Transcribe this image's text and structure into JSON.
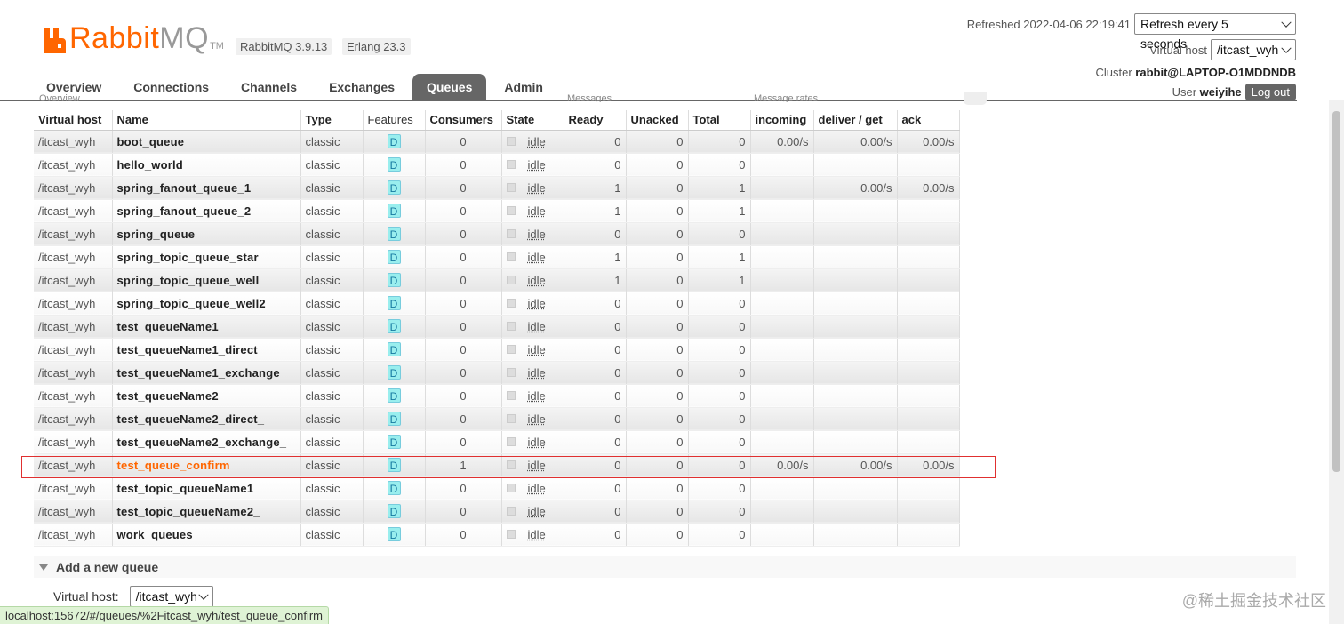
{
  "header": {
    "brand_r": "Rabbit",
    "brand_mq": "MQ",
    "trademark": "TM",
    "version": "RabbitMQ 3.9.13",
    "erlang": "Erlang 23.3",
    "refreshed_label": "Refreshed 2022-04-06 22:19:41",
    "refresh_select": "Refresh every 5 seconds",
    "vhost_label": "Virtual host",
    "vhost_select": "/itcast_wyh",
    "cluster_label": "Cluster",
    "cluster_value": "rabbit@LAPTOP-O1MDDNDB",
    "user_label": "User",
    "user_value": "weiyihe",
    "logout": "Log out"
  },
  "tabs": [
    "Overview",
    "Connections",
    "Channels",
    "Exchanges",
    "Queues",
    "Admin"
  ],
  "active_tab": "Queues",
  "partial_labels": {
    "overview": "Overview",
    "messages": "Messages",
    "rates": "Message rates"
  },
  "columns": [
    "Virtual host",
    "Name",
    "Type",
    "Features",
    "Consumers",
    "State",
    "Ready",
    "Unacked",
    "Total",
    "incoming",
    "deliver / get",
    "ack"
  ],
  "queues": [
    {
      "vhost": "/itcast_wyh",
      "name": "boot_queue",
      "type": "classic",
      "feature": "D",
      "consumers": "0",
      "state": "idle",
      "ready": "0",
      "unacked": "0",
      "total": "0",
      "incoming": "0.00/s",
      "deliver": "0.00/s",
      "ack": "0.00/s"
    },
    {
      "vhost": "/itcast_wyh",
      "name": "hello_world",
      "type": "classic",
      "feature": "D",
      "consumers": "0",
      "state": "idle",
      "ready": "0",
      "unacked": "0",
      "total": "0",
      "incoming": "",
      "deliver": "",
      "ack": ""
    },
    {
      "vhost": "/itcast_wyh",
      "name": "spring_fanout_queue_1",
      "type": "classic",
      "feature": "D",
      "consumers": "0",
      "state": "idle",
      "ready": "1",
      "unacked": "0",
      "total": "1",
      "incoming": "",
      "deliver": "0.00/s",
      "ack": "0.00/s"
    },
    {
      "vhost": "/itcast_wyh",
      "name": "spring_fanout_queue_2",
      "type": "classic",
      "feature": "D",
      "consumers": "0",
      "state": "idle",
      "ready": "1",
      "unacked": "0",
      "total": "1",
      "incoming": "",
      "deliver": "",
      "ack": ""
    },
    {
      "vhost": "/itcast_wyh",
      "name": "spring_queue",
      "type": "classic",
      "feature": "D",
      "consumers": "0",
      "state": "idle",
      "ready": "0",
      "unacked": "0",
      "total": "0",
      "incoming": "",
      "deliver": "",
      "ack": ""
    },
    {
      "vhost": "/itcast_wyh",
      "name": "spring_topic_queue_star",
      "type": "classic",
      "feature": "D",
      "consumers": "0",
      "state": "idle",
      "ready": "1",
      "unacked": "0",
      "total": "1",
      "incoming": "",
      "deliver": "",
      "ack": ""
    },
    {
      "vhost": "/itcast_wyh",
      "name": "spring_topic_queue_well",
      "type": "classic",
      "feature": "D",
      "consumers": "0",
      "state": "idle",
      "ready": "1",
      "unacked": "0",
      "total": "1",
      "incoming": "",
      "deliver": "",
      "ack": ""
    },
    {
      "vhost": "/itcast_wyh",
      "name": "spring_topic_queue_well2",
      "type": "classic",
      "feature": "D",
      "consumers": "0",
      "state": "idle",
      "ready": "0",
      "unacked": "0",
      "total": "0",
      "incoming": "",
      "deliver": "",
      "ack": ""
    },
    {
      "vhost": "/itcast_wyh",
      "name": "test_queueName1",
      "type": "classic",
      "feature": "D",
      "consumers": "0",
      "state": "idle",
      "ready": "0",
      "unacked": "0",
      "total": "0",
      "incoming": "",
      "deliver": "",
      "ack": ""
    },
    {
      "vhost": "/itcast_wyh",
      "name": "test_queueName1_direct",
      "type": "classic",
      "feature": "D",
      "consumers": "0",
      "state": "idle",
      "ready": "0",
      "unacked": "0",
      "total": "0",
      "incoming": "",
      "deliver": "",
      "ack": ""
    },
    {
      "vhost": "/itcast_wyh",
      "name": "test_queueName1_exchange",
      "type": "classic",
      "feature": "D",
      "consumers": "0",
      "state": "idle",
      "ready": "0",
      "unacked": "0",
      "total": "0",
      "incoming": "",
      "deliver": "",
      "ack": ""
    },
    {
      "vhost": "/itcast_wyh",
      "name": "test_queueName2",
      "type": "classic",
      "feature": "D",
      "consumers": "0",
      "state": "idle",
      "ready": "0",
      "unacked": "0",
      "total": "0",
      "incoming": "",
      "deliver": "",
      "ack": ""
    },
    {
      "vhost": "/itcast_wyh",
      "name": "test_queueName2_direct_",
      "type": "classic",
      "feature": "D",
      "consumers": "0",
      "state": "idle",
      "ready": "0",
      "unacked": "0",
      "total": "0",
      "incoming": "",
      "deliver": "",
      "ack": ""
    },
    {
      "vhost": "/itcast_wyh",
      "name": "test_queueName2_exchange_",
      "type": "classic",
      "feature": "D",
      "consumers": "0",
      "state": "idle",
      "ready": "0",
      "unacked": "0",
      "total": "0",
      "incoming": "",
      "deliver": "",
      "ack": ""
    },
    {
      "vhost": "/itcast_wyh",
      "name": "test_queue_confirm",
      "type": "classic",
      "feature": "D",
      "consumers": "1",
      "state": "idle",
      "ready": "0",
      "unacked": "0",
      "total": "0",
      "incoming": "0.00/s",
      "deliver": "0.00/s",
      "ack": "0.00/s",
      "highlighted": true
    },
    {
      "vhost": "/itcast_wyh",
      "name": "test_topic_queueName1",
      "type": "classic",
      "feature": "D",
      "consumers": "0",
      "state": "idle",
      "ready": "0",
      "unacked": "0",
      "total": "0",
      "incoming": "",
      "deliver": "",
      "ack": ""
    },
    {
      "vhost": "/itcast_wyh",
      "name": "test_topic_queueName2_",
      "type": "classic",
      "feature": "D",
      "consumers": "0",
      "state": "idle",
      "ready": "0",
      "unacked": "0",
      "total": "0",
      "incoming": "",
      "deliver": "",
      "ack": ""
    },
    {
      "vhost": "/itcast_wyh",
      "name": "work_queues",
      "type": "classic",
      "feature": "D",
      "consumers": "0",
      "state": "idle",
      "ready": "0",
      "unacked": "0",
      "total": "0",
      "incoming": "",
      "deliver": "",
      "ack": ""
    }
  ],
  "add_queue": {
    "section_title": "Add a new queue",
    "vhost_label": "Virtual host:",
    "vhost_value": "/itcast_wyh"
  },
  "status_url": "localhost:15672/#/queues/%2Fitcast_wyh/test_queue_confirm",
  "watermark": "@稀土掘金技术社区",
  "colors": {
    "brand_orange": "#ff6600",
    "tab_active": "#666666",
    "highlight_box": "#e03030",
    "feature_badge": "#99eeee"
  }
}
